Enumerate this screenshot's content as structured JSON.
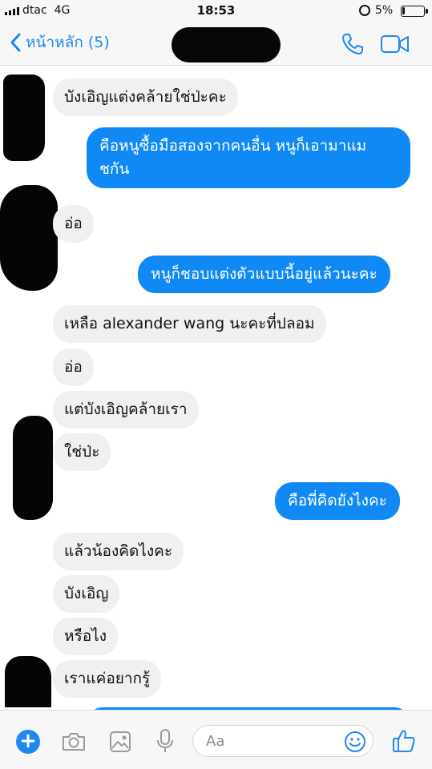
{
  "status_bar": {
    "carrier": "dtac",
    "network": "4G",
    "time": "18:53",
    "battery_percent": "5%",
    "signal_icon": "signal-bars-icon",
    "rotation_lock_icon": "rotation-lock-icon",
    "battery_icon": "battery-low-icon"
  },
  "nav": {
    "back_label": "หน้าหลัก (5)",
    "back_icon": "chevron-left-icon",
    "call_icon": "phone-icon",
    "video_icon": "video-camera-icon",
    "accent_color": "#1e88f5"
  },
  "messages": [
    {
      "side": "incoming",
      "text": "บังเอิญแต่งคล้ายใช่ป่ะคะ"
    },
    {
      "side": "outgoing",
      "lines": [
        "คือหนูซื้อมือสองจากคนอื่น หนูก็เอามาแม",
        "ชกัน"
      ]
    },
    {
      "side": "incoming",
      "text": "อ่อ"
    },
    {
      "side": "outgoing",
      "text": "หนูก็ชอบแต่งตัวแบบนี้อยู่แล้วนะคะ"
    },
    {
      "side": "incoming",
      "text": "เหลือ alexander wang นะคะที่ปลอม"
    },
    {
      "side": "incoming",
      "text": "อ่อ"
    },
    {
      "side": "incoming",
      "text": "แต่บังเอิญคล้ายเรา"
    },
    {
      "side": "incoming",
      "text": "ใช่ป่ะ"
    },
    {
      "side": "outgoing",
      "text": "คือพี่คิดยังไงคะ"
    },
    {
      "side": "incoming",
      "text": "แล้วน้องคิดไงคะ"
    },
    {
      "side": "incoming",
      "text": "บังเอิญ"
    },
    {
      "side": "incoming",
      "text": "หรือไง"
    },
    {
      "side": "incoming",
      "text": "เราแค่อยากรู้"
    }
  ],
  "colors": {
    "outgoing_bubble": "#1089f5",
    "incoming_bubble": "#f0f0f0"
  },
  "composer": {
    "placeholder": "Aa",
    "icons": [
      "plus-icon",
      "camera-icon",
      "image-icon",
      "microphone-icon",
      "emoji-icon",
      "thumbs-up-icon"
    ]
  }
}
